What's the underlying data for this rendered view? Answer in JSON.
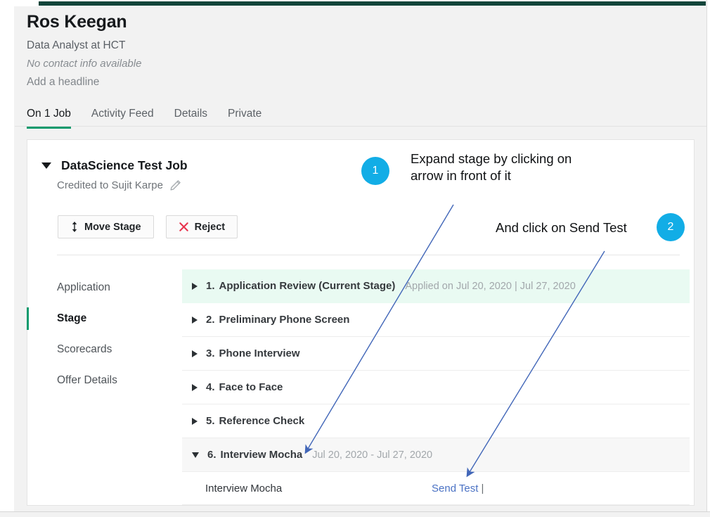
{
  "theme": {
    "topbar_green": "#12453a",
    "accent_green": "#0c9a6d",
    "current_stage_bg": "#e9faf2",
    "link_blue": "#4b72c4",
    "annotation_blue": "#12ade6",
    "arrow_blue": "#4166b8",
    "reject_red": "#e8344e"
  },
  "profile": {
    "name": "Ros Keegan",
    "role": "Data Analyst at HCT",
    "contact": "No contact info available",
    "headline": "Add a headline"
  },
  "tabs": [
    {
      "label": "On 1 Job",
      "active": true
    },
    {
      "label": "Activity Feed",
      "active": false
    },
    {
      "label": "Details",
      "active": false
    },
    {
      "label": "Private",
      "active": false
    }
  ],
  "job": {
    "title": "DataScience Test Job",
    "credited_to": "Credited to Sujit Karpe",
    "edit_icon": "pencil-icon",
    "collapse_icon": "caret-down-icon",
    "buttons": [
      {
        "label": "Move Stage",
        "icon": "move-vertical-icon"
      },
      {
        "label": "Reject",
        "icon": "close-x-icon"
      }
    ]
  },
  "sub_nav": [
    {
      "label": "Application",
      "active": false
    },
    {
      "label": "Stage",
      "active": true
    },
    {
      "label": "Scorecards",
      "active": false
    },
    {
      "label": "Offer Details",
      "active": false
    }
  ],
  "stages": [
    {
      "number": "1.",
      "label": "Application Review (Current Stage)",
      "meta": "Applied on Jul 20, 2020 | Jul 27, 2020",
      "state": "current",
      "expanded": false
    },
    {
      "number": "2.",
      "label": "Preliminary Phone Screen",
      "meta": "",
      "state": "normal",
      "expanded": false
    },
    {
      "number": "3.",
      "label": "Phone Interview",
      "meta": "",
      "state": "normal",
      "expanded": false
    },
    {
      "number": "4.",
      "label": "Face to Face",
      "meta": "",
      "state": "normal",
      "expanded": false
    },
    {
      "number": "5.",
      "label": "Reference Check",
      "meta": "",
      "state": "normal",
      "expanded": false
    },
    {
      "number": "6.",
      "label": "Interview Mocha",
      "meta": "Jul 20, 2020 - Jul 27, 2020",
      "state": "expanded",
      "expanded": true
    }
  ],
  "stage_detail": {
    "name": "Interview Mocha",
    "action_link": "Send Test",
    "separator": "|"
  },
  "annotations": [
    {
      "badge": "1",
      "text_line_1": "Expand stage by clicking on",
      "text_line_2": "arrow in front of it"
    },
    {
      "badge": "2",
      "text_line_1": "And click on Send Test",
      "text_line_2": ""
    }
  ]
}
